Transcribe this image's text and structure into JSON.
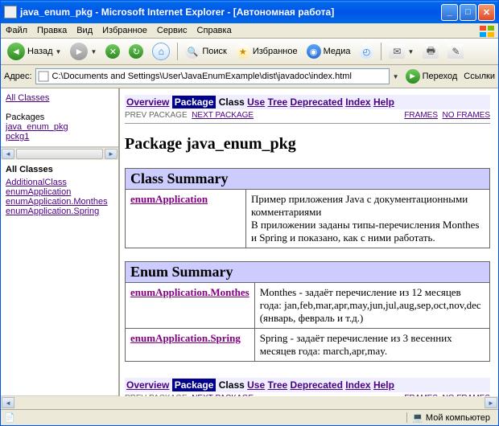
{
  "window": {
    "title": "java_enum_pkg - Microsoft Internet Explorer - [Автономная работа]"
  },
  "menu": {
    "file": "Файл",
    "edit": "Правка",
    "view": "Вид",
    "favorites": "Избранное",
    "tools": "Сервис",
    "help": "Справка"
  },
  "toolbar": {
    "back": "Назад",
    "search": "Поиск",
    "favorites": "Избранное",
    "media": "Медиа"
  },
  "address": {
    "label": "Адрес:",
    "value": "C:\\Documents and Settings\\User\\JavaEnumExample\\dist\\javadoc\\index.html",
    "go": "Переход",
    "links": "Ссылки"
  },
  "left_top": {
    "all_classes": "All Classes",
    "packages_label": "Packages",
    "pkg1": "java_enum_pkg",
    "pkg2": "pckg1"
  },
  "left_bot": {
    "heading": "All Classes",
    "c1": "AdditionalClass",
    "c2": "enumApplication",
    "c3": "enumApplication.Monthes",
    "c4": "enumApplication.Spring"
  },
  "nav": {
    "overview": "Overview",
    "package": "Package",
    "class": "Class",
    "use": "Use",
    "tree": "Tree",
    "deprecated": "Deprecated",
    "index": "Index",
    "help": "Help",
    "prev": "PREV PACKAGE",
    "next": "NEXT PACKAGE",
    "frames": "FRAMES",
    "noframes": "NO FRAMES"
  },
  "main": {
    "heading": "Package java_enum_pkg",
    "class_summary": "Class Summary",
    "enum_summary": "Enum Summary",
    "classes": [
      {
        "name": "enumApplication",
        "desc": "Пример приложения Java с документационными комментариями<br>В приложении заданы типы-перечисления Monthes и Spring и показано, как с ними работать."
      }
    ],
    "enums": [
      {
        "name": "enumApplication.Monthes",
        "desc": "Monthes - задаёт перечисление из 12 месяцев года: jan,feb,mar,apr,may,jun,jul,aug,sep,oct,nov,dec (январь, февраль и т.д.)"
      },
      {
        "name": "enumApplication.Spring",
        "desc": "Spring - задаёт перечисление из 3 весенних месяцев года: march,apr,may."
      }
    ]
  },
  "status": {
    "zone": "Мой компьютер"
  }
}
